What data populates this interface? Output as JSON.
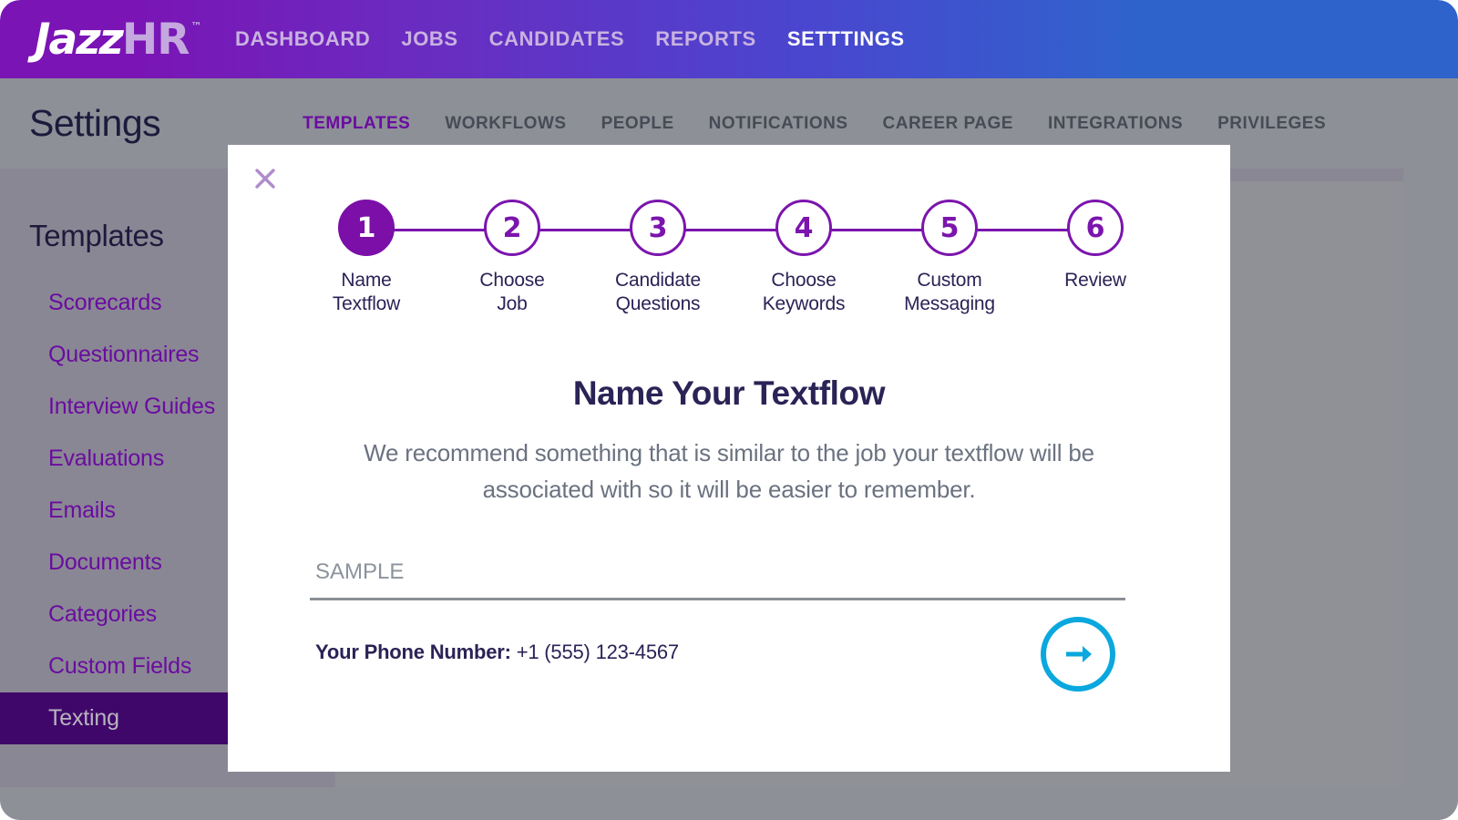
{
  "brand": {
    "logo_primary": "Jazz",
    "logo_secondary": "HR",
    "trademark": "™",
    "accent_purple": "#7b0fa8",
    "accent_cyan": "#0aa8de",
    "nav_gradient_from": "#7a14b5",
    "nav_gradient_to": "#2f63cc"
  },
  "topnav": {
    "items": [
      {
        "label": "DASHBOARD",
        "active": false
      },
      {
        "label": "JOBS",
        "active": false
      },
      {
        "label": "CANDIDATES",
        "active": false
      },
      {
        "label": "REPORTS",
        "active": false
      },
      {
        "label": "SETTTINGS",
        "active": true
      }
    ]
  },
  "settings": {
    "title": "Settings",
    "tabs": [
      {
        "label": "TEMPLATES",
        "active": true
      },
      {
        "label": "WORKFLOWS",
        "active": false
      },
      {
        "label": "PEOPLE",
        "active": false
      },
      {
        "label": "NOTIFICATIONS",
        "active": false
      },
      {
        "label": "CAREER PAGE",
        "active": false
      },
      {
        "label": "INTEGRATIONS",
        "active": false
      },
      {
        "label": "PRIVILEGES",
        "active": false
      }
    ]
  },
  "sidebar": {
    "heading": "Templates",
    "items": [
      {
        "label": "Scorecards",
        "active": false
      },
      {
        "label": "Questionnaires",
        "active": false
      },
      {
        "label": "Interview Guides",
        "active": false
      },
      {
        "label": "Evaluations",
        "active": false
      },
      {
        "label": "Emails",
        "active": false
      },
      {
        "label": "Documents",
        "active": false
      },
      {
        "label": "Categories",
        "active": false
      },
      {
        "label": "Custom Fields",
        "active": false
      },
      {
        "label": "Texting",
        "active": true
      }
    ]
  },
  "modal": {
    "close_icon": "close-icon",
    "stepper": {
      "current_step": 1,
      "steps": [
        {
          "number": "1",
          "label": "Name\nTextflow",
          "active": true
        },
        {
          "number": "2",
          "label": "Choose\nJob",
          "active": false
        },
        {
          "number": "3",
          "label": "Candidate\nQuestions",
          "active": false
        },
        {
          "number": "4",
          "label": "Choose\nKeywords",
          "active": false
        },
        {
          "number": "5",
          "label": "Custom\nMessaging",
          "active": false
        },
        {
          "number": "6",
          "label": "Review",
          "active": false
        }
      ]
    },
    "title": "Name Your Textflow",
    "description": "We recommend something that is similar to the job your textflow will be associated with so it will be easier to remember.",
    "name_field": {
      "value": "",
      "placeholder": "SAMPLE"
    },
    "phone": {
      "label": "Your Phone Number:",
      "value": "+1 (555) 123-4567"
    },
    "next_button": {
      "icon": "arrow-right-icon",
      "aria_label": "Next"
    }
  }
}
